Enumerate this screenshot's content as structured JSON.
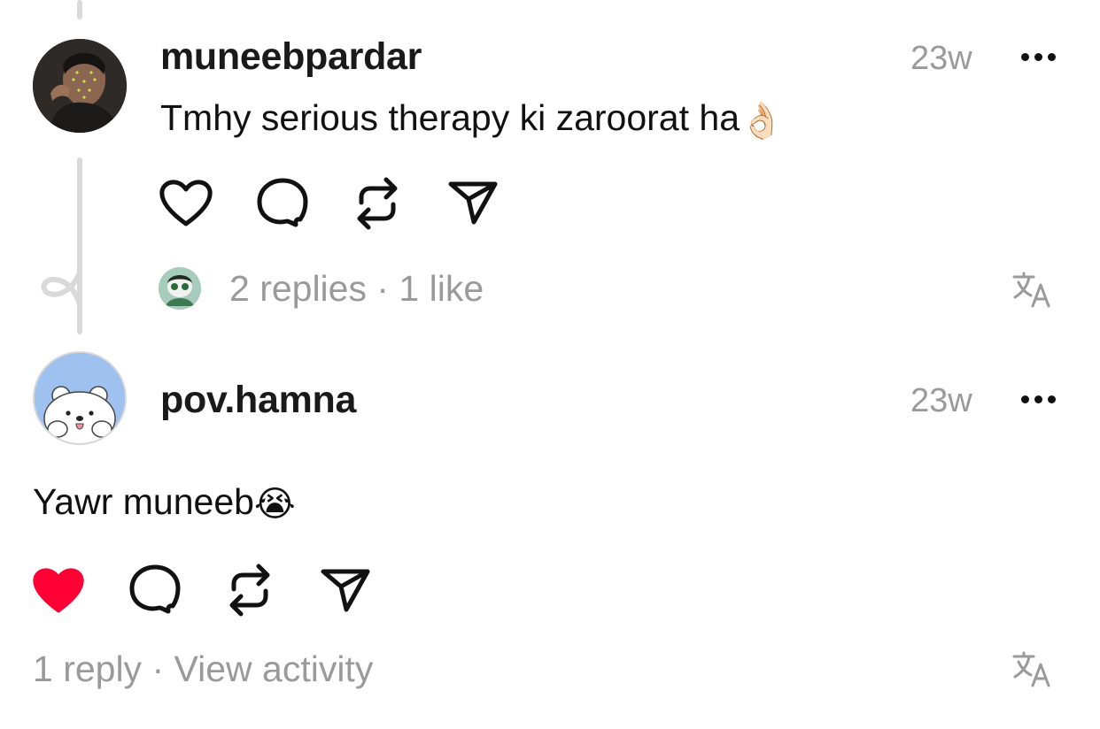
{
  "comments": [
    {
      "username": "muneebpardar",
      "time": "23w",
      "text": "Tmhy serious therapy ki zaroorat ha",
      "emoji": "👌🏻",
      "meta": "2 replies · 1 like",
      "liked": false
    },
    {
      "username": "pov.hamna",
      "time": "23w",
      "text": "Yawr muneeb",
      "emoji": "😭",
      "meta": "1 reply · View activity",
      "liked": true
    }
  ],
  "icons": {
    "like": "heart-icon",
    "reply": "comment-bubble-icon",
    "repost": "repost-icon",
    "share": "send-icon",
    "more": "more-dots-icon",
    "translate": "translate-icon"
  },
  "colors": {
    "like_active": "#ff0034",
    "muted_text": "#9a9a9a",
    "thread_line": "#d9d9d9"
  }
}
